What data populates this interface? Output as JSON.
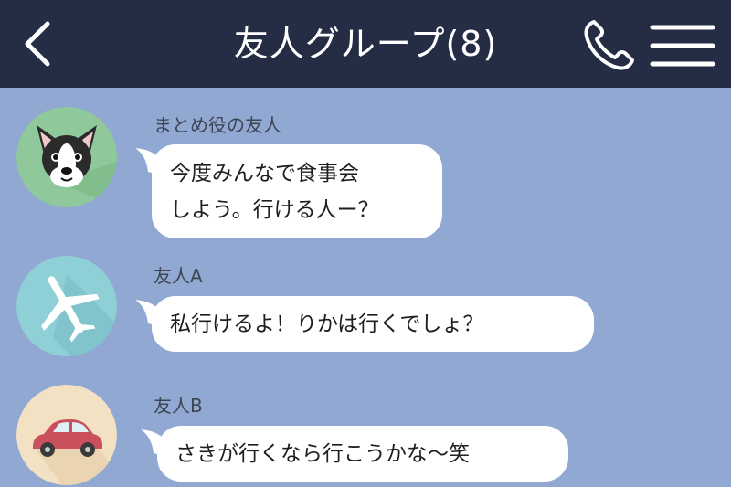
{
  "header": {
    "title": "友人グループ(8)",
    "back_icon": "chevron-left-icon",
    "call_icon": "phone-icon",
    "menu_icon": "hamburger-menu-icon",
    "background": "#242d44"
  },
  "chat": {
    "background": "#91a9d2",
    "messages": [
      {
        "sender": "まとめ役の友人",
        "avatar_icon": "boston-terrier-dog-icon",
        "lines": [
          "今度みんなで食事会",
          "しよう。行ける人ー？"
        ]
      },
      {
        "sender": "友人A",
        "avatar_icon": "airplane-icon",
        "lines": [
          "私行けるよ！りかは行くでしょ？"
        ]
      },
      {
        "sender": "友人B",
        "avatar_icon": "car-icon",
        "lines": [
          "さきが行くなら行こうかな〜笑"
        ]
      }
    ]
  }
}
